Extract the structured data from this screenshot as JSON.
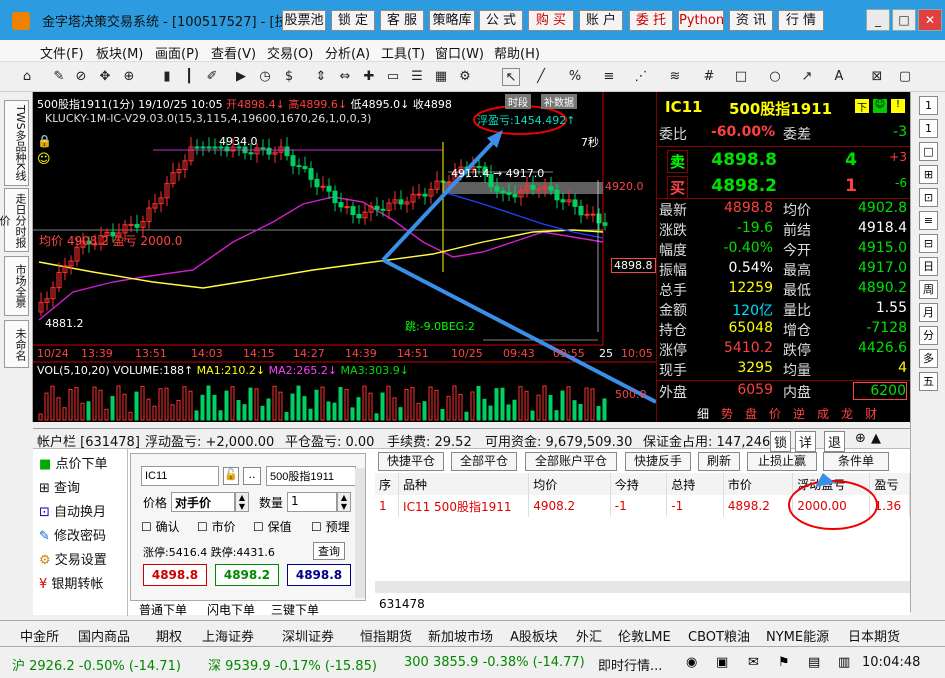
{
  "window": {
    "title": "金字塔决策交易系统 - [100517527] - [技",
    "controls": [
      "_",
      "□",
      "✕"
    ]
  },
  "topbuttons": [
    {
      "label": "股票池"
    },
    {
      "label": "锁 定"
    },
    {
      "label": "客 服"
    },
    {
      "label": "策略库"
    },
    {
      "label": "公 式"
    },
    {
      "label": "购 买"
    },
    {
      "label": "账 户"
    },
    {
      "label": "委 托"
    },
    {
      "label": "Python"
    },
    {
      "label": "资 讯"
    },
    {
      "label": "行 情"
    }
  ],
  "menu": [
    "文件(F)",
    "板块(M)",
    "画面(P)",
    "查看(V)",
    "交易(O)",
    "分析(A)",
    "工具(T)",
    "窗口(W)",
    "帮助(H)"
  ],
  "lefttabs": [
    "TWS多品种K线",
    "走日分时报价",
    "市场全景",
    "未命名"
  ],
  "chart": {
    "header": "500股指1911(1分) 19/10/25 10:05",
    "open": "开4898.4↓",
    "high": "高4899.6↓",
    "low": "低4895.0↓",
    "close": "收4898",
    "tags": [
      "时段",
      "补数据"
    ],
    "formula": "KLUCKY-1M-IC-V29.03.0(15,3,115,4,19600,1670,26,1,0,0,3)",
    "float_profit": "浮盈亏:1454.492↑",
    "label_4934": "4934.0",
    "label_4911": "4911.4 → 4917.0",
    "label_4920": "4920.0",
    "label_4898": "4898.8",
    "label_4881": "4881.2",
    "avgprice": "均价 4908.2 盈亏 2000.0",
    "jump": "跳:-9.0BEG:2",
    "seconds": "7秒",
    "xaxis": [
      "10/24",
      "13:39",
      "13:51",
      "14:03",
      "14:15",
      "14:27",
      "14:39",
      "14:51",
      "10/25",
      "09:43",
      "09:55",
      "25",
      "10:05"
    ],
    "vol": "VOL(5,10,20) VOLUME:188↑",
    "ma1": "MA1:210.2↓",
    "ma2": "MA2:265.2↓",
    "ma3": "MA3:303.9↓",
    "vol500": "500.0"
  },
  "quote": {
    "code": "IC11",
    "name": "500股指1911",
    "weibi_l": "委比",
    "weibi_v": "-60.00%",
    "weicha_l": "委差",
    "weicha_v": "-3",
    "sell_l": "卖",
    "sell_p": "4898.8",
    "sell_q": "4",
    "sell_c": "+3",
    "buy_l": "买",
    "buy_p": "4898.2",
    "buy_q": "1",
    "buy_c": "-6",
    "rows": [
      {
        "l1": "最新",
        "v1": "4898.8",
        "l2": "均价",
        "v2": "4902.8",
        "c1": "red",
        "c2": "green"
      },
      {
        "l1": "涨跌",
        "v1": "-19.6",
        "l2": "前结",
        "v2": "4918.4",
        "c1": "green",
        "c2": "white"
      },
      {
        "l1": "幅度",
        "v1": "-0.40%",
        "l2": "今开",
        "v2": "4915.0",
        "c1": "green",
        "c2": "green"
      },
      {
        "l1": "振幅",
        "v1": "0.54%",
        "l2": "最高",
        "v2": "4917.0",
        "c1": "white",
        "c2": "green"
      },
      {
        "l1": "总手",
        "v1": "12259",
        "l2": "最低",
        "v2": "4890.2",
        "c1": "yellow",
        "c2": "green"
      },
      {
        "l1": "金额",
        "v1": "120亿",
        "l2": "量比",
        "v2": "1.55",
        "c1": "cyan",
        "c2": "white"
      },
      {
        "l1": "持仓",
        "v1": "65048",
        "l2": "增仓",
        "v2": "-7128",
        "c1": "yellow",
        "c2": "green"
      },
      {
        "l1": "涨停",
        "v1": "5410.2",
        "l2": "跌停",
        "v2": "4426.6",
        "c1": "red",
        "c2": "green"
      },
      {
        "l1": "现手",
        "v1": "3295",
        "l2": "均量",
        "v2": "4",
        "c1": "yellow",
        "c2": "yellow"
      }
    ],
    "waipan_l": "外盘",
    "waipan_v": "6059",
    "neipan_l": "内盘",
    "neipan_v": "6200",
    "tabs": [
      "细",
      "势",
      "盘",
      "价",
      "逆",
      "成",
      "龙",
      "财"
    ]
  },
  "rightbar": [
    "1",
    "1",
    "□",
    "⊞",
    "⊡",
    "≡",
    "⊟",
    "日",
    "周",
    "月",
    "分",
    "多",
    "五"
  ],
  "account": {
    "bar": {
      "title": "帐户栏 [631478]",
      "float": "浮动盈亏: +2,000.00",
      "flat": "平仓盈亏: 0.00",
      "fee": "手续费: 29.52",
      "avail": "可用资金: 9,679,509.30",
      "margin": "保证金占用: 147,246",
      "tools": [
        "锁",
        "详",
        "退"
      ]
    },
    "nav": [
      "点价下单",
      "查询",
      "自动换月",
      "修改密码",
      "交易设置",
      "银期转帐"
    ],
    "order": {
      "code": "IC11",
      "name": "500股指1911",
      "price_l": "价格",
      "price_v": "对手价",
      "qty_l": "数量",
      "qty_v": "1",
      "confirm": "确认",
      "market": "市价",
      "guard": "保值",
      "pre": "预埋",
      "limits": "涨停:5416.4 跌停:4431.6",
      "view": "查询",
      "b1": "4898.8",
      "b2": "4898.2",
      "b3": "4898.8"
    },
    "ordertabs": [
      "普通下单",
      "闪电下单",
      "三键下单"
    ],
    "buttons": [
      "快捷平仓",
      "全部平仓",
      "全部账户平仓",
      "快捷反手",
      "刷新",
      "止损止赢",
      "条件单"
    ],
    "table": {
      "headers": [
        "序",
        "品种",
        "均价",
        "今持",
        "总持",
        "市价",
        "浮动盈亏",
        "盈亏"
      ],
      "rows": [
        [
          "1",
          "IC11 500股指1911",
          "4908.2",
          "-1",
          "-1",
          "4898.2",
          "2000.00",
          "1.36"
        ]
      ]
    },
    "account_id": "631478"
  },
  "bottomtabs": [
    "中金所",
    "国内商品",
    "期权",
    "上海证券",
    "深圳证券",
    "恒指期货",
    "新加坡市场",
    "A股板块",
    "外汇",
    "伦敦LME",
    "CBOT粮油",
    "NYME能源",
    "日本期货"
  ],
  "status": {
    "sh": "沪 2926.2 -0.50% (-14.71)",
    "sz": "深 9539.9 -0.17% (-15.85)",
    "s300": "300 3855.9 -0.38% (-14.77)",
    "news": "即时行情...",
    "time": "10:04:48"
  }
}
